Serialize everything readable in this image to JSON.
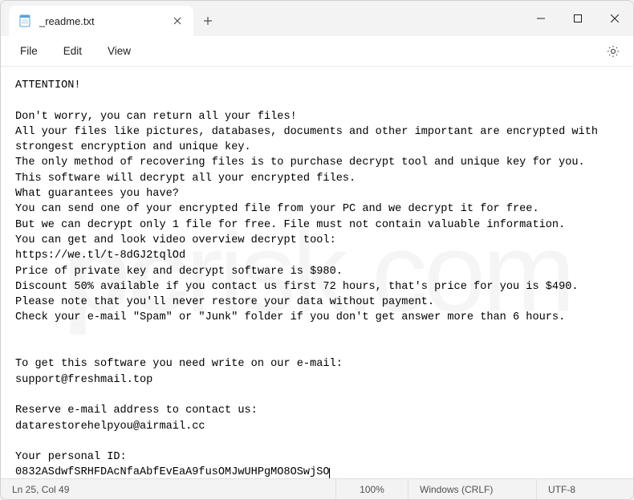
{
  "tab": {
    "title": "_readme.txt"
  },
  "menu": {
    "file": "File",
    "edit": "Edit",
    "view": "View"
  },
  "content": {
    "text": "ATTENTION!\n\nDon't worry, you can return all your files!\nAll your files like pictures, databases, documents and other important are encrypted with strongest encryption and unique key.\nThe only method of recovering files is to purchase decrypt tool and unique key for you.\nThis software will decrypt all your encrypted files.\nWhat guarantees you have?\nYou can send one of your encrypted file from your PC and we decrypt it for free.\nBut we can decrypt only 1 file for free. File must not contain valuable information.\nYou can get and look video overview decrypt tool:\nhttps://we.tl/t-8dGJ2tqlOd\nPrice of private key and decrypt software is $980.\nDiscount 50% available if you contact us first 72 hours, that's price for you is $490.\nPlease note that you'll never restore your data without payment.\nCheck your e-mail \"Spam\" or \"Junk\" folder if you don't get answer more than 6 hours.\n\n\nTo get this software you need write on our e-mail:\nsupport@freshmail.top\n\nReserve e-mail address to contact us:\ndatarestorehelpyou@airmail.cc\n\nYour personal ID:\n0832ASdwfSRHFDAcNfaAbfEvEaA9fusOMJwUHPgMO8OSwjSO"
  },
  "status": {
    "position": "Ln 25, Col 49",
    "zoom": "100%",
    "eol": "Windows (CRLF)",
    "encoding": "UTF-8"
  },
  "watermark": {
    "part1": "pc",
    "part2": "risk.com"
  }
}
